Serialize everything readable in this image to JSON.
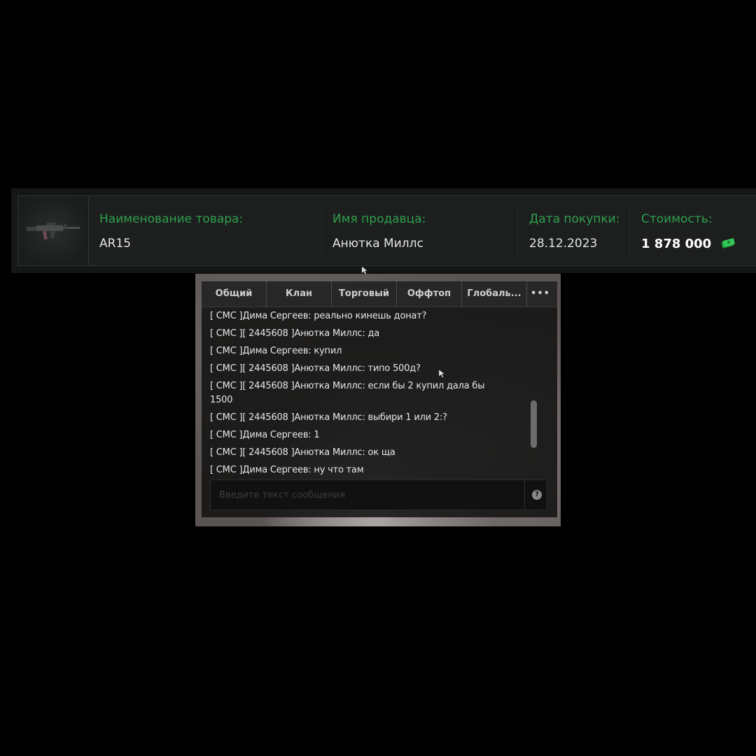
{
  "purchase": {
    "item_label": "Наименование товара:",
    "item_value": "AR15",
    "seller_label": "Имя продавца:",
    "seller_value": "Анютка Миллс",
    "date_label": "Дата покупки:",
    "date_value": "28.12.2023",
    "price_label": "Стоимость:",
    "price_value": "1 878 000",
    "item_icon": "rifle-icon",
    "price_icon": "money-icon"
  },
  "chat": {
    "tabs": [
      {
        "label": "Общий"
      },
      {
        "label": "Клан"
      },
      {
        "label": "Торговый"
      },
      {
        "label": "Оффтоп"
      },
      {
        "label": "Глобаль..."
      },
      {
        "label": "•••"
      }
    ],
    "messages": [
      "[ СМС ]Дима Сергеев: реально кинешь донат?",
      "[ СМС ][ 2445608 ]Анютка Миллс: да",
      "[ СМС ]Дима Сергеев: купил",
      "[ СМС ][ 2445608 ]Анютка Миллс: типо 500д?",
      "[ СМС ][ 2445608 ]Анютка Миллс: если бы 2 купил дала бы 1500",
      "[ СМС ][ 2445608 ]Анютка Миллс: выбири 1 или 2:?",
      "[ СМС ]Дима Сергеев: 1",
      "[ СМС ][ 2445608 ]Анютка Миллс: ок ща",
      "[ СМС ]Дима Сергеев: ну что там"
    ],
    "input_placeholder": "Введите текст сообщения",
    "help_label": "?"
  },
  "colors": {
    "accent_green": "#2fa04e",
    "background": "#000000"
  }
}
